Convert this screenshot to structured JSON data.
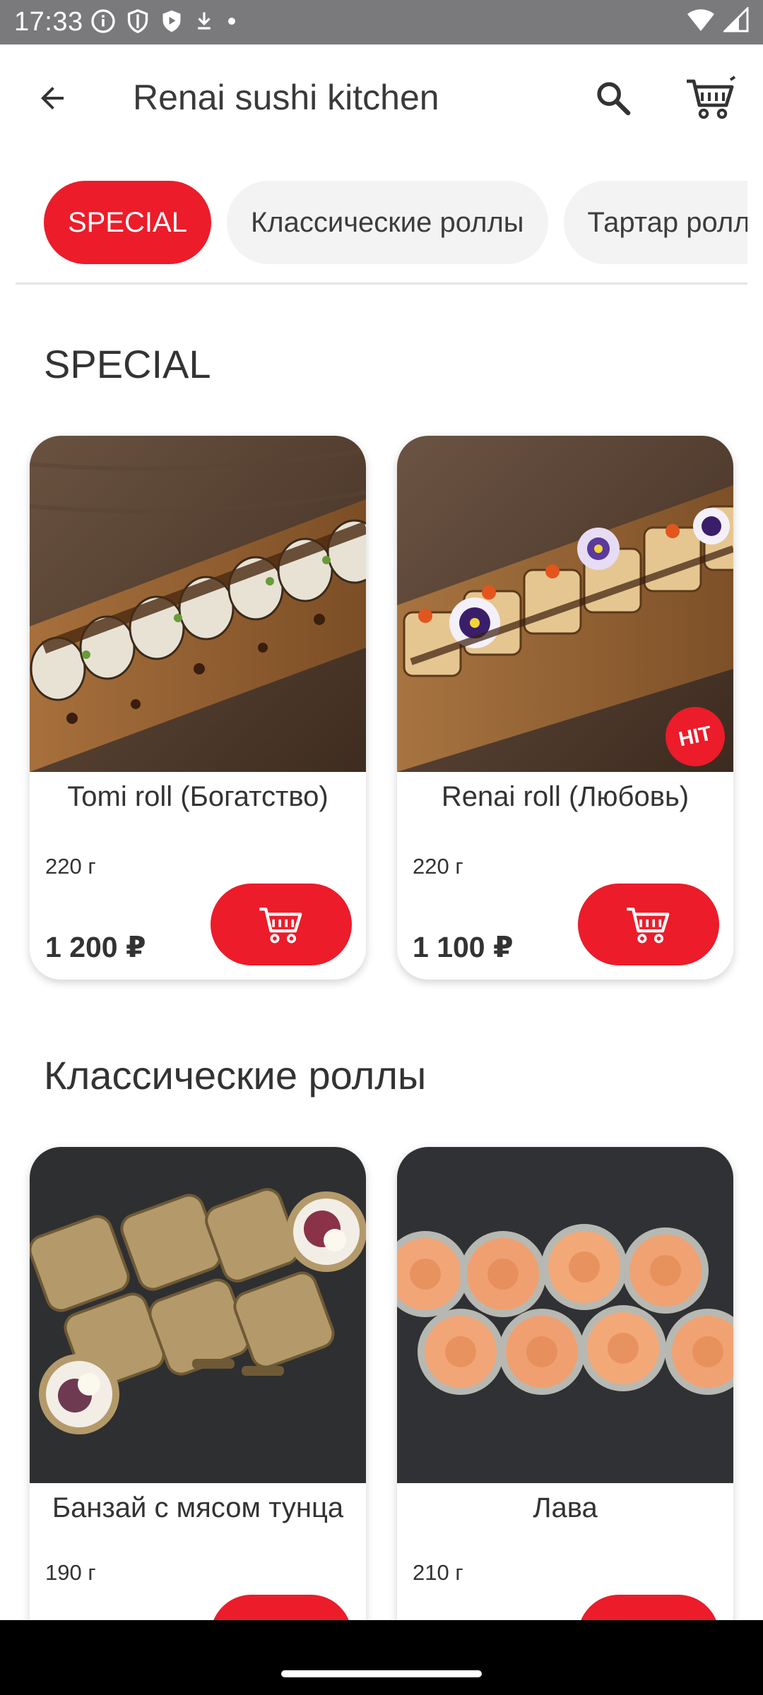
{
  "status_bar": {
    "time": "17:33",
    "icons": [
      "info-icon",
      "shield-icon",
      "play-shield-icon",
      "download-icon",
      "dot-icon",
      "wifi-icon",
      "signal-icon"
    ]
  },
  "appbar": {
    "title": "Renai sushi kitchen",
    "back_icon": "arrow-back-icon",
    "search_icon": "search-icon",
    "cart_icon": "cart-icon"
  },
  "categories": [
    {
      "label": "SPECIAL",
      "active": true
    },
    {
      "label": "Классические роллы",
      "active": false
    },
    {
      "label": "Тартар роллы",
      "active": false
    }
  ],
  "sections": [
    {
      "title": "SPECIAL",
      "items": [
        {
          "name": "Tomi roll (Богатство)",
          "weight": "220 г",
          "price": "1 200 ₽",
          "badge": ""
        },
        {
          "name": "Renai roll (Любовь)",
          "weight": "220 г",
          "price": "1 100 ₽",
          "badge": "HIT"
        }
      ]
    },
    {
      "title": "Классические роллы",
      "items": [
        {
          "name": "Банзай с мясом тунца",
          "weight": "190 г",
          "price": "",
          "badge": ""
        },
        {
          "name": "Лава",
          "weight": "210 г",
          "price": "",
          "badge": ""
        }
      ]
    }
  ],
  "colors": {
    "accent": "#ec1c2a",
    "status_bar": "#7a7a7c",
    "chip_bg": "#f3f3f3",
    "text": "#333333"
  }
}
